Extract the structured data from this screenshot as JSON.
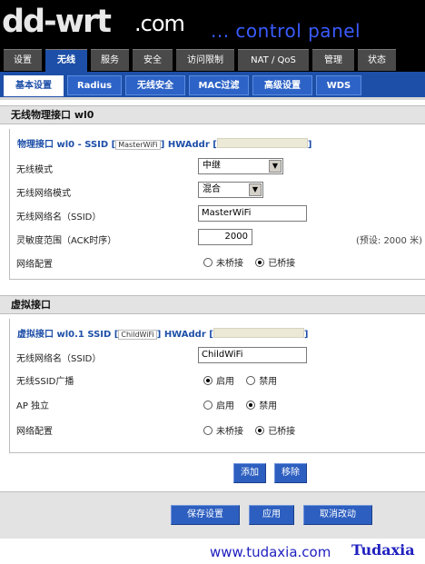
{
  "header": {
    "logo": "dd-wrt",
    "logo_suffix": ".com",
    "tagline": "... control panel"
  },
  "main_tabs": [
    {
      "label": "设置"
    },
    {
      "label": "无线"
    },
    {
      "label": "服务"
    },
    {
      "label": "安全"
    },
    {
      "label": "访问限制"
    },
    {
      "label": "NAT / QoS"
    },
    {
      "label": "管理"
    },
    {
      "label": "状态"
    }
  ],
  "sub_tabs": [
    {
      "label": "基本设置"
    },
    {
      "label": "Radius"
    },
    {
      "label": "无线安全"
    },
    {
      "label": "MAC过滤"
    },
    {
      "label": "高级设置"
    },
    {
      "label": "WDS"
    }
  ],
  "physical": {
    "section_title": "无线物理接口 wl0",
    "legend_prefix": "物理接口 wl0 - SSID [",
    "legend_ssid": "MasterWiFi",
    "legend_mid": "] HWAddr [",
    "legend_end": "]",
    "mode_label": "无线模式",
    "mode_value": "中继",
    "net_mode_label": "无线网络模式",
    "net_mode_value": "混合",
    "ssid_label": "无线网络名（SSID）",
    "ssid_value": "MasterWiFi",
    "sensitivity_label": "灵敏度范围（ACK时序）",
    "sensitivity_value": "2000",
    "sensitivity_hint": "(预设: 2000 米)",
    "network_label": "网络配置",
    "opt_unbridged": "未桥接",
    "opt_bridged": "已桥接"
  },
  "virtual": {
    "section_title": "虚拟接口",
    "legend_prefix": "虚拟接口 wl0.1 SSID [",
    "legend_ssid": "ChildWiFi",
    "legend_mid": "] HWAddr [",
    "legend_end": "]",
    "ssid_label": "无线网络名（SSID）",
    "ssid_value": "ChildWiFi",
    "broadcast_label": "无线SSID广播",
    "ap_label": "AP 独立",
    "network_label": "网络配置",
    "opt_enable": "启用",
    "opt_disable": "禁用",
    "opt_unbridged": "未桥接",
    "opt_bridged": "已桥接"
  },
  "buttons": {
    "add": "添加",
    "remove": "移除",
    "save": "保存设置",
    "apply": "应用",
    "cancel": "取消改动"
  },
  "watermark": {
    "url": "www.tudaxia.com",
    "brand": "Tudaxia"
  }
}
